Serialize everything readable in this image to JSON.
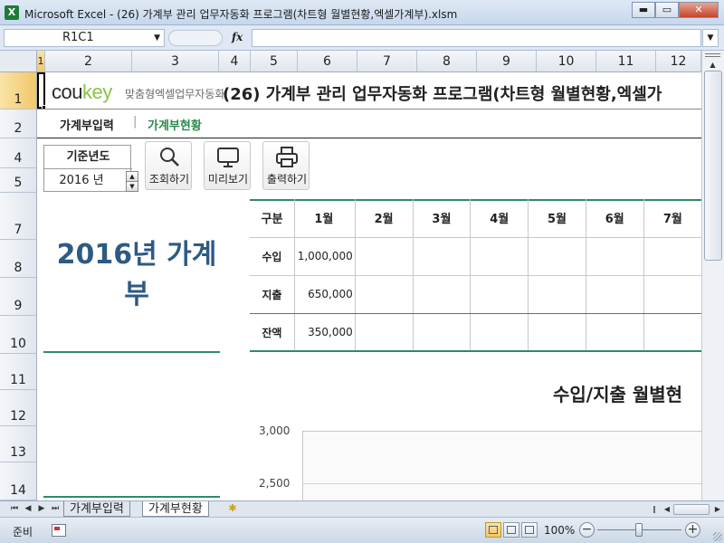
{
  "window": {
    "app_icon": "X",
    "title": "Microsoft Excel - (26) 가계부 관리 업무자동화 프로그램(차트형 월별현황,엑셀가계부).xlsm",
    "min": "▬",
    "max": "▭",
    "close": "✕"
  },
  "formula_bar": {
    "name_box": "R1C1",
    "fx": "fx",
    "formula": ""
  },
  "columns": [
    "1",
    "2",
    "3",
    "4",
    "5",
    "6",
    "7",
    "8",
    "9",
    "10",
    "11",
    "12"
  ],
  "rows": [
    "1",
    "2",
    "4",
    "5",
    "7",
    "8",
    "9",
    "10",
    "11",
    "12",
    "13",
    "14"
  ],
  "header": {
    "logo_part1": "cou",
    "logo_part2": "key",
    "logo_sub": "맞춤형엑셀업무자동화",
    "title": "(26) 가계부 관리 업무자동화 프로그램(차트형 월별현황,엑셀가"
  },
  "nav": {
    "item1": "가계부입력",
    "separator": "|",
    "item2": "가계부현황"
  },
  "year_selector": {
    "label": "기준년도",
    "value": "2016 년"
  },
  "toolbar": {
    "search": "조회하기",
    "preview": "미리보기",
    "print": "출력하기"
  },
  "big_title": "2016년 가계부",
  "table": {
    "headers": [
      "구분",
      "1월",
      "2월",
      "3월",
      "4월",
      "5월",
      "6월",
      "7월"
    ],
    "rows": [
      {
        "label": "수입",
        "values": [
          "1,000,000",
          "",
          "",
          "",
          "",
          "",
          ""
        ]
      },
      {
        "label": "지출",
        "values": [
          "650,000",
          "",
          "",
          "",
          "",
          "",
          ""
        ]
      },
      {
        "label": "잔액",
        "values": [
          "350,000",
          "",
          "",
          "",
          "",
          "",
          ""
        ]
      }
    ]
  },
  "chart": {
    "title": "수입/지출 월별현",
    "yticks": [
      "3,000",
      "2,500"
    ]
  },
  "sheet_tabs": {
    "tab1": "가계부입력",
    "tab2": "가계부현황"
  },
  "status": {
    "ready": "준비",
    "zoom": "100%",
    "zoom_minus": "−",
    "zoom_plus": "+"
  }
}
